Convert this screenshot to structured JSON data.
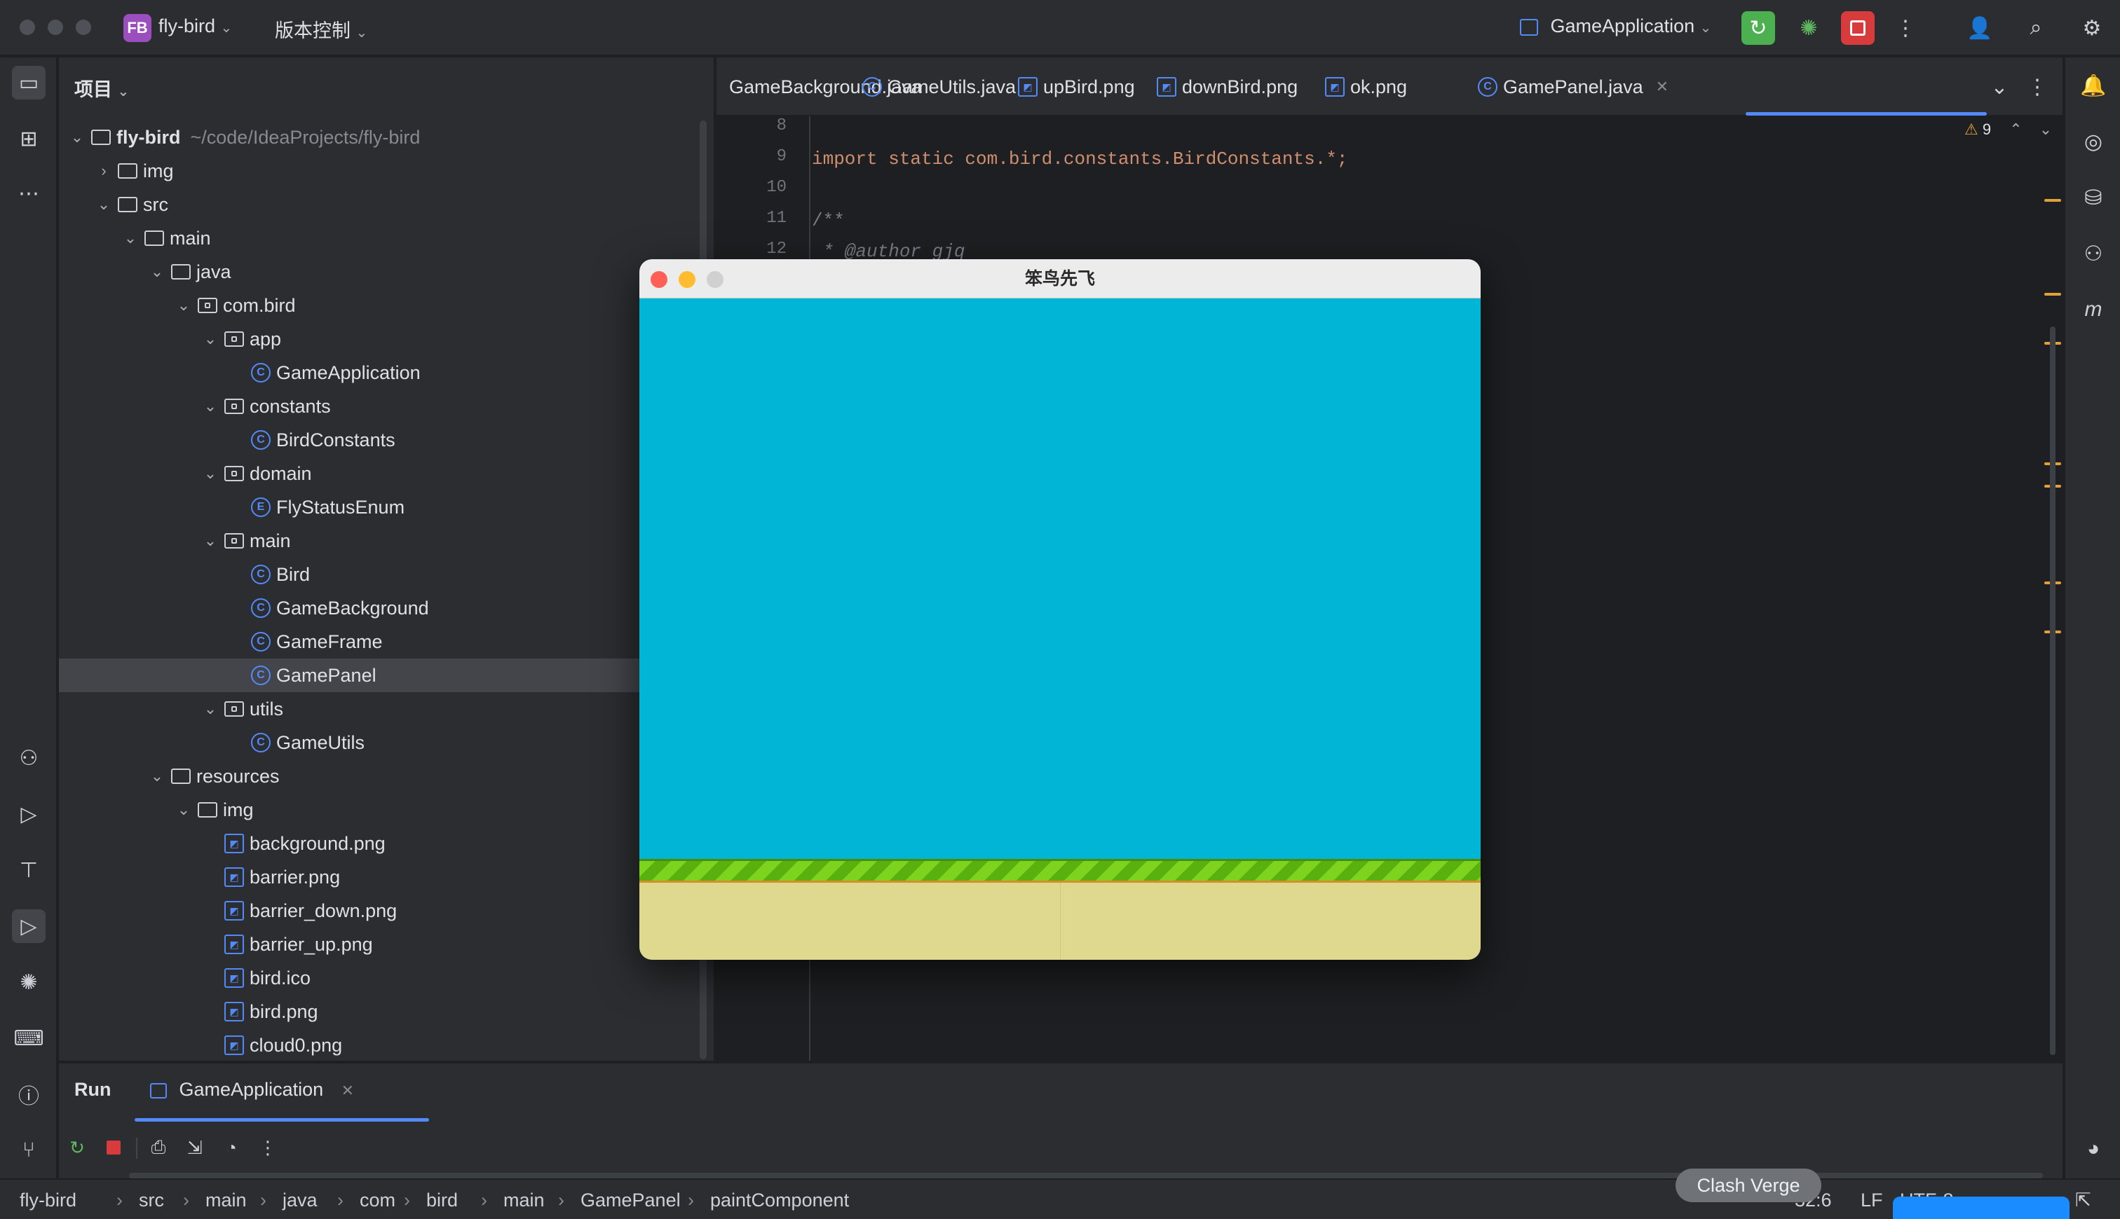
{
  "titlebar": {
    "project_badge": "FB",
    "project_name": "fly-bird",
    "vcs_label": "版本控制",
    "run_config": "GameApplication",
    "icons": [
      "rerun-icon",
      "debug-icon",
      "stop-icon",
      "more-icon",
      "add-user-icon",
      "search-icon",
      "settings-icon"
    ]
  },
  "project_panel": {
    "title": "项目",
    "tree": [
      {
        "label": "fly-bird",
        "path": "~/code/IdeaProjects/fly-bird",
        "icon": "folder",
        "depth": 0,
        "chevron": "down",
        "bold": true
      },
      {
        "label": "img",
        "icon": "folder",
        "depth": 1,
        "chevron": "right"
      },
      {
        "label": "src",
        "icon": "folder",
        "depth": 1,
        "chevron": "down"
      },
      {
        "label": "main",
        "icon": "folder",
        "depth": 2,
        "chevron": "down"
      },
      {
        "label": "java",
        "icon": "folder",
        "depth": 3,
        "chevron": "down"
      },
      {
        "label": "com.bird",
        "icon": "package",
        "depth": 4,
        "chevron": "down"
      },
      {
        "label": "app",
        "icon": "package",
        "depth": 5,
        "chevron": "down"
      },
      {
        "label": "GameApplication",
        "icon": "class",
        "depth": 6
      },
      {
        "label": "constants",
        "icon": "package",
        "depth": 5,
        "chevron": "down"
      },
      {
        "label": "BirdConstants",
        "icon": "class",
        "depth": 6
      },
      {
        "label": "domain",
        "icon": "package",
        "depth": 5,
        "chevron": "down"
      },
      {
        "label": "FlyStatusEnum",
        "icon": "enum",
        "depth": 6
      },
      {
        "label": "main",
        "icon": "package",
        "depth": 5,
        "chevron": "down"
      },
      {
        "label": "Bird",
        "icon": "class",
        "depth": 6
      },
      {
        "label": "GameBackground",
        "icon": "class",
        "depth": 6
      },
      {
        "label": "GameFrame",
        "icon": "class",
        "depth": 6
      },
      {
        "label": "GamePanel",
        "icon": "class",
        "depth": 6,
        "selected": true
      },
      {
        "label": "utils",
        "icon": "package",
        "depth": 5,
        "chevron": "down"
      },
      {
        "label": "GameUtils",
        "icon": "class",
        "depth": 6
      },
      {
        "label": "resources",
        "icon": "folder",
        "depth": 3,
        "chevron": "down"
      },
      {
        "label": "img",
        "icon": "folder",
        "depth": 4,
        "chevron": "down"
      },
      {
        "label": "background.png",
        "icon": "image",
        "depth": 5
      },
      {
        "label": "barrier.png",
        "icon": "image",
        "depth": 5
      },
      {
        "label": "barrier_down.png",
        "icon": "image",
        "depth": 5
      },
      {
        "label": "barrier_up.png",
        "icon": "image",
        "depth": 5
      },
      {
        "label": "bird.ico",
        "icon": "image",
        "depth": 5
      },
      {
        "label": "bird.png",
        "icon": "image",
        "depth": 5
      },
      {
        "label": "cloud0.png",
        "icon": "image",
        "depth": 5
      }
    ]
  },
  "editor": {
    "tabs": [
      {
        "label": "GameBackground.java",
        "icon": "none"
      },
      {
        "label": "GameUtils.java",
        "icon": "class"
      },
      {
        "label": "upBird.png",
        "icon": "image"
      },
      {
        "label": "downBird.png",
        "icon": "image"
      },
      {
        "label": "ok.png",
        "icon": "image"
      },
      {
        "label": "GamePanel.java",
        "icon": "class",
        "active": true
      }
    ],
    "warning_count": "9",
    "lines": [
      {
        "no": "8",
        "text": ""
      },
      {
        "no": "9",
        "text": "import static com.bird.constants.BirdConstants.*;"
      },
      {
        "no": "10",
        "text": ""
      },
      {
        "no": "11",
        "text": "/**"
      },
      {
        "no": "12",
        "text": " * @author gjq"
      }
    ]
  },
  "game_window": {
    "title": "笨鸟先飞",
    "sky_color": "#00b5d6",
    "grass_color": "#7dd31d",
    "ground_color": "#dfd88f"
  },
  "run_panel": {
    "title": "Run",
    "tab_label": "GameApplication"
  },
  "statusbar": {
    "breadcrumbs": [
      "fly-bird",
      "src",
      "main",
      "java",
      "com",
      "bird",
      "main",
      "GamePanel",
      "paintComponent"
    ],
    "position": "32:6",
    "line_ending": "LF",
    "encoding": "UTF-8"
  },
  "overlay": {
    "toast": "Clash Verge"
  },
  "colors": {
    "accent": "#548af7",
    "background": "#1e1f22",
    "panel": "#2b2d30",
    "warning": "#e0a13a",
    "stop_red": "#d83b3b",
    "run_green": "#4caf50"
  }
}
